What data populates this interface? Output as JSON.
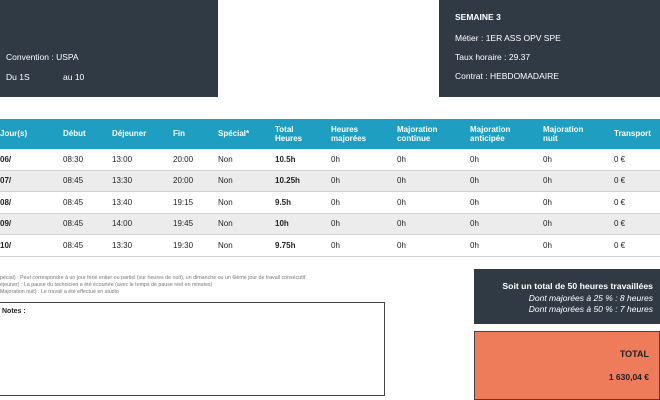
{
  "header_left": {
    "convention": "Convention : USPA",
    "period_from": "Du 1S",
    "period_to": "au 10"
  },
  "header_right": {
    "week": "SEMAINE 3",
    "metier": "Métier : 1ER ASS OPV SPE",
    "taux": "Taux horaire : 29.37",
    "contrat": "Contrat : HEBDOMADAIRE"
  },
  "table": {
    "headers": [
      {
        "line1": "Jour(s)",
        "line2": ""
      },
      {
        "line1": "Début",
        "line2": ""
      },
      {
        "line1": "Déjeuner",
        "line2": ""
      },
      {
        "line1": "Fin",
        "line2": ""
      },
      {
        "line1": "Spécial*",
        "line2": ""
      },
      {
        "line1": "Total",
        "line2": "Heures"
      },
      {
        "line1": "Heures",
        "line2": "majorées"
      },
      {
        "line1": "Majoration",
        "line2": "continue"
      },
      {
        "line1": "Majoration",
        "line2": "anticipée"
      },
      {
        "line1": "Majoration",
        "line2": "nuit"
      },
      {
        "line1": "Transport",
        "line2": ""
      }
    ],
    "rows": [
      [
        "06/",
        "08:30",
        "13:00",
        "20:00",
        "Non",
        "10.5h",
        "0h",
        "0h",
        "0h",
        "0h",
        "0 €"
      ],
      [
        "07/",
        "08:45",
        "13:30",
        "20:00",
        "Non",
        "10.25h",
        "0h",
        "0h",
        "0h",
        "0h",
        "0 €"
      ],
      [
        "08/",
        "08:45",
        "13:40",
        "19:15",
        "Non",
        "9.5h",
        "0h",
        "0h",
        "0h",
        "0h",
        "0 €"
      ],
      [
        "09/",
        "08:45",
        "14:00",
        "19:45",
        "Non",
        "10h",
        "0h",
        "0h",
        "0h",
        "0h",
        "0 €"
      ],
      [
        "10/",
        "08:45",
        "13:30",
        "19:30",
        "Non",
        "9.75h",
        "0h",
        "0h",
        "0h",
        "0h",
        "0 €"
      ]
    ]
  },
  "legend": {
    "line1": "pécial) : Peut correspondre à un jour férié entier ou partiel (sur heures de nuit), un dimanche ou un 6ième jour de travail consécutif",
    "line2": "éjeuner) : La pause du technicien a été écourtée (avec le temps de pause réel en minutes)",
    "line3": "Majoration nuit) : Le travail a été effectué en studio"
  },
  "notes": {
    "title": "Notes :"
  },
  "summary": {
    "main": "Soit un total de 50 heures travaillées",
    "sub1": "Dont majorées à 25 % : 8 heures",
    "sub2": "Dont majorées à 50 % : 7 heures"
  },
  "total": {
    "label": "TOTAL",
    "value": "1 630,04 €"
  }
}
